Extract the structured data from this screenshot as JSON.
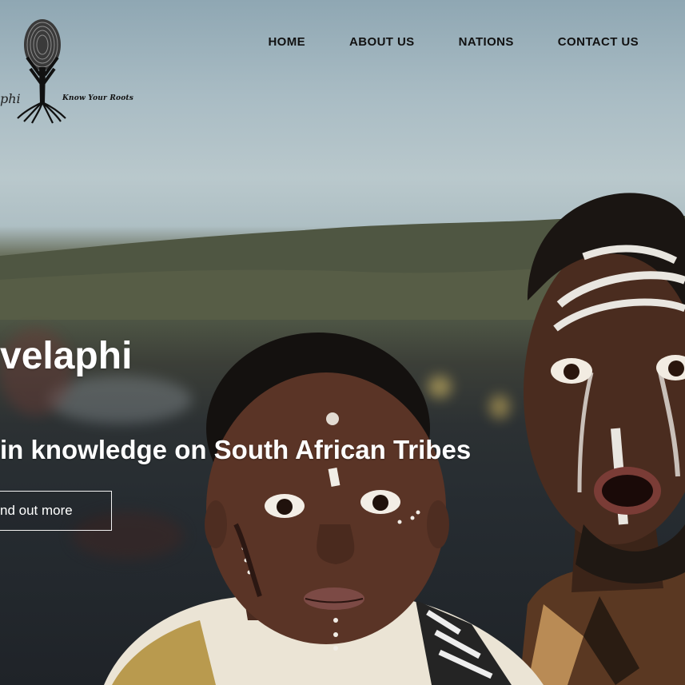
{
  "logo": {
    "left_text": "phi",
    "tagline": "Know Your Roots"
  },
  "nav": {
    "items": [
      "HOME",
      "ABOUT US",
      "NATIONS",
      "CONTACT US"
    ]
  },
  "hero": {
    "title": "velaphi",
    "subtitle": "in knowledge on South African Tribes",
    "cta_label": "nd out more"
  },
  "colors": {
    "text_dark": "#111111",
    "text_light": "#ffffff"
  }
}
